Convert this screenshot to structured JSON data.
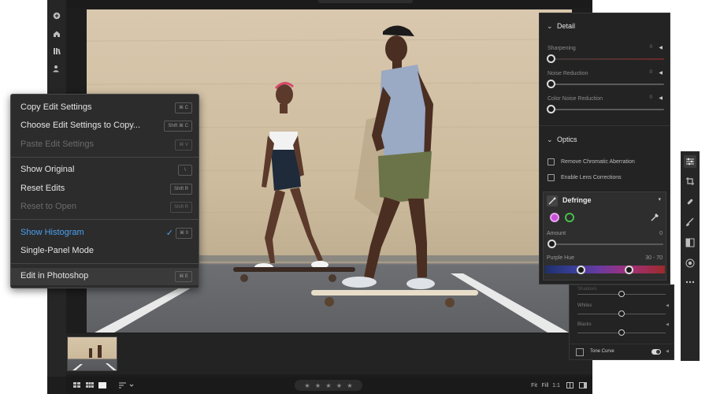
{
  "context_menu": {
    "items": [
      {
        "label": "Copy Edit Settings",
        "shortcut": "⌘ C",
        "state": "normal"
      },
      {
        "label": "Choose Edit Settings to Copy...",
        "shortcut": "Shift ⌘ C",
        "state": "normal"
      },
      {
        "label": "Paste Edit Settings",
        "shortcut": "⌘ V",
        "state": "disabled"
      },
      {
        "label": "Show Original",
        "shortcut": "\\",
        "state": "normal"
      },
      {
        "label": "Reset Edits",
        "shortcut": "Shift R",
        "state": "normal"
      },
      {
        "label": "Reset to Open",
        "shortcut": "Shift R",
        "state": "disabled"
      },
      {
        "label": "Show Histogram",
        "shortcut": "⌘ 0",
        "state": "checked"
      },
      {
        "label": "Single-Panel Mode",
        "shortcut": "",
        "state": "normal"
      },
      {
        "label": "Edit in Photoshop",
        "shortcut": "⌘ E",
        "state": "highlight"
      }
    ]
  },
  "detail_panel": {
    "title": "Detail",
    "sliders": [
      {
        "label": "Sharpening",
        "value": "0",
        "level": 0
      },
      {
        "label": "Noise Reduction",
        "value": "0",
        "level": 0
      },
      {
        "label": "Color Noise Reduction",
        "value": "0",
        "level": 0
      }
    ]
  },
  "optics_panel": {
    "title": "Optics",
    "checkboxes": [
      {
        "label": "Remove Chromatic Aberration",
        "checked": false
      },
      {
        "label": "Enable Lens Corrections",
        "checked": false
      }
    ]
  },
  "defringe": {
    "title": "Defringe",
    "amount_label": "Amount",
    "amount_value": "0",
    "purple_hue_label": "Purple Hue",
    "purple_hue_value": "30 - 70",
    "purple_hue_low": 30,
    "purple_hue_high": 70,
    "swatch_colors": [
      "#c94fd6",
      "#46c04a"
    ]
  },
  "light_panel": {
    "sliders": [
      {
        "label": "Shadows",
        "level": 0.5
      },
      {
        "label": "Whites",
        "level": 0.5
      },
      {
        "label": "Blacks",
        "level": 0.5
      }
    ],
    "tone_curve_label": "Tone Curve"
  },
  "bottom_bar": {
    "fit_label": "Fit",
    "fill_label": "Fill",
    "ratio_label": "1:1",
    "stars": [
      "★",
      "★",
      "★",
      "★",
      "★"
    ]
  },
  "colors": {
    "accent": "#4aa0f0",
    "panel": "#232323",
    "menu": "#2c2c2c"
  }
}
